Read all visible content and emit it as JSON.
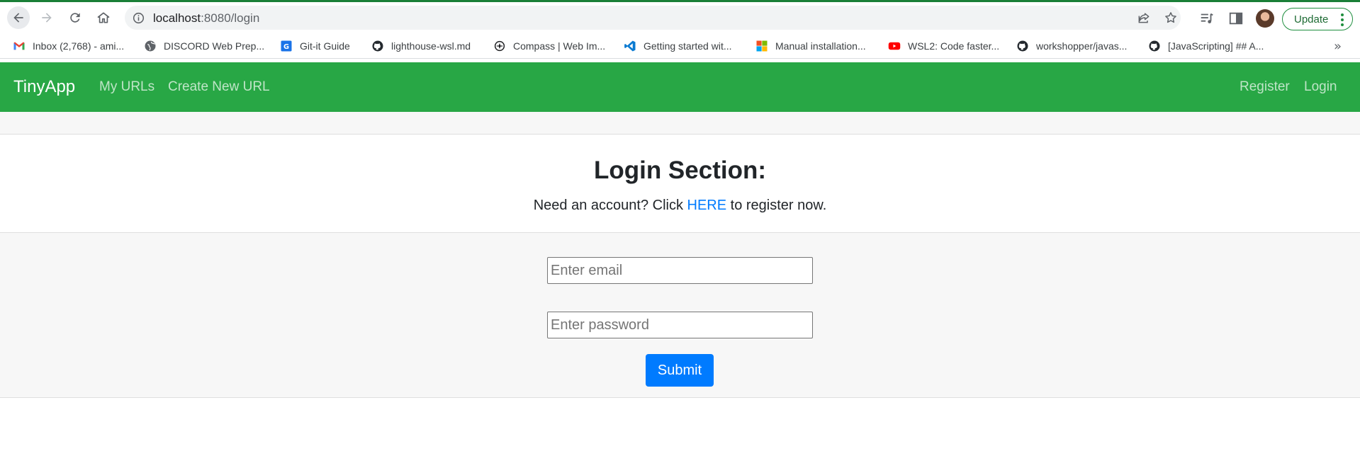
{
  "browser": {
    "url_host": "localhost",
    "url_path": ":8080/login",
    "update_label": "Update"
  },
  "bookmarks": [
    {
      "label": "Inbox (2,768) - ami...",
      "icon": "gmail-icon"
    },
    {
      "label": "DISCORD Web Prep...",
      "icon": "globe-icon"
    },
    {
      "label": "Git-it Guide",
      "icon": "git-it-icon"
    },
    {
      "label": "lighthouse-wsl.md",
      "icon": "github-icon"
    },
    {
      "label": "Compass | Web Im...",
      "icon": "compass-icon"
    },
    {
      "label": "Getting started wit...",
      "icon": "vscode-icon"
    },
    {
      "label": "Manual installation...",
      "icon": "microsoft-icon"
    },
    {
      "label": "WSL2: Code faster...",
      "icon": "youtube-icon"
    },
    {
      "label": "workshopper/javas...",
      "icon": "github-icon"
    },
    {
      "label": "[JavaScripting] ## A...",
      "icon": "github-icon"
    }
  ],
  "app": {
    "brand": "TinyApp",
    "nav_left": [
      "My URLs",
      "Create New URL"
    ],
    "nav_right": [
      "Register",
      "Login"
    ],
    "accent_color": "#28a745"
  },
  "login": {
    "title": "Login Section:",
    "prompt_before": "Need an account? Click ",
    "link_text": "HERE",
    "prompt_after": " to register now.",
    "email_placeholder": "Enter email",
    "email_value": "",
    "password_placeholder": "Enter password",
    "password_value": "",
    "submit_label": "Submit",
    "button_color": "#007bff"
  }
}
